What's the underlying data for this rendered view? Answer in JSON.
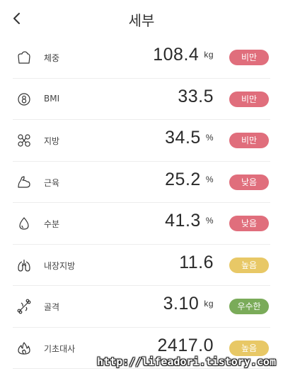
{
  "header": {
    "title": "세부",
    "back_icon": "chevron-left-icon"
  },
  "colors": {
    "high": "#e06e7c",
    "mid": "#e8c866",
    "good": "#7aab59"
  },
  "metrics": [
    {
      "key": "weight",
      "icon": "scale-icon",
      "label": "체중",
      "value": "108.4",
      "unit": "kg",
      "status": "비만",
      "status_color": "#e06e7c"
    },
    {
      "key": "bmi",
      "icon": "bmi-icon",
      "label": "BMI",
      "value": "33.5",
      "unit": "",
      "status": "비만",
      "status_color": "#e06e7c"
    },
    {
      "key": "fat",
      "icon": "fat-icon",
      "label": "지방",
      "value": "34.5",
      "unit": "%",
      "status": "비만",
      "status_color": "#e06e7c"
    },
    {
      "key": "muscle",
      "icon": "muscle-icon",
      "label": "근육",
      "value": "25.2",
      "unit": "%",
      "status": "낮음",
      "status_color": "#e06e7c"
    },
    {
      "key": "water",
      "icon": "water-drop-icon",
      "label": "수분",
      "value": "41.3",
      "unit": "%",
      "status": "낮음",
      "status_color": "#e06e7c"
    },
    {
      "key": "visceral",
      "icon": "lungs-icon",
      "label": "내장지방",
      "value": "11.6",
      "unit": "",
      "status": "높음",
      "status_color": "#e8c866"
    },
    {
      "key": "bone",
      "icon": "bone-icon",
      "label": "골격",
      "value": "3.10",
      "unit": "kg",
      "status": "우수한",
      "status_color": "#7aab59"
    },
    {
      "key": "bmr",
      "icon": "flame-icon",
      "label": "기초대사",
      "value": "2417.0",
      "unit": "",
      "status": "높음",
      "status_color": "#e8c866"
    }
  ],
  "watermark": "http://lifeadori.tistory.com"
}
